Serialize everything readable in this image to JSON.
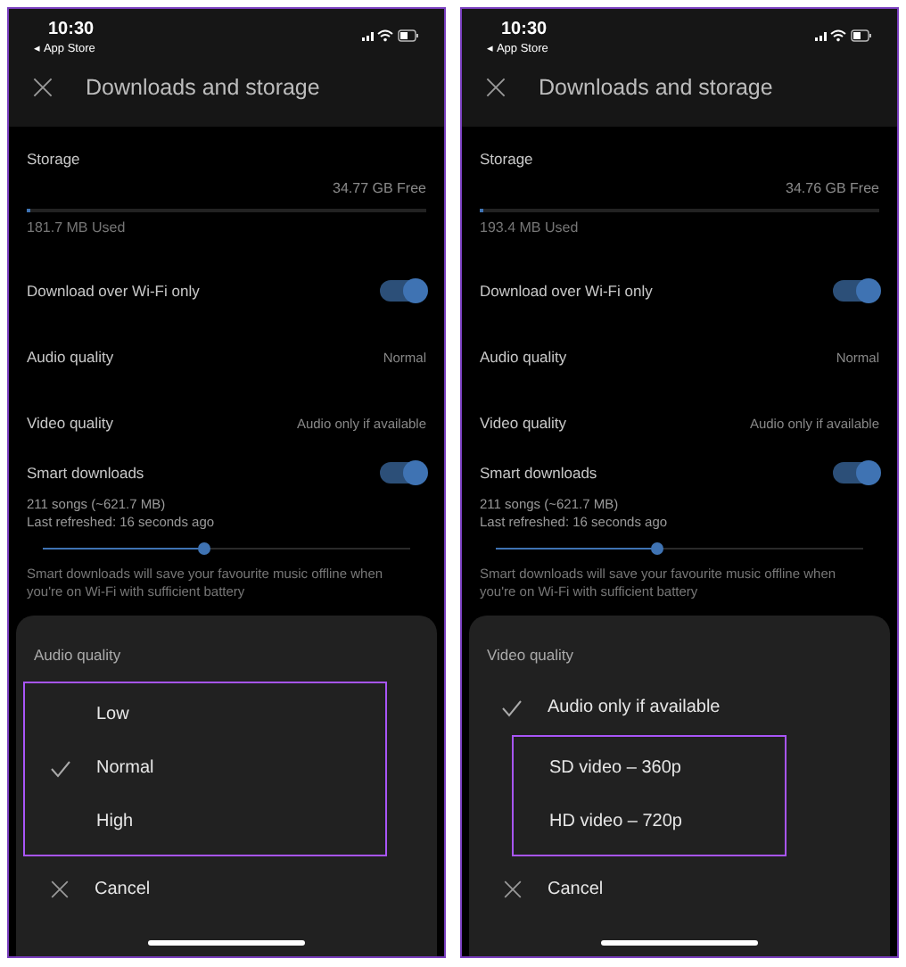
{
  "screens": [
    {
      "status_bar": {
        "time": "10:30",
        "back_label": "◂ App Store"
      },
      "header": {
        "title": "Downloads and storage"
      },
      "storage": {
        "label": "Storage",
        "free": "34.77 GB Free",
        "level": 0.01,
        "used": "181.7 MB Used"
      },
      "settings": [
        {
          "kind": "toggle",
          "label": "Download over Wi-Fi only",
          "on": true
        },
        {
          "kind": "value",
          "label": "Audio quality",
          "value": "Normal"
        },
        {
          "kind": "value",
          "label": "Video quality",
          "value": "Audio only if available"
        }
      ],
      "smart_downloads": {
        "label": "Smart downloads",
        "on": true,
        "count": "211 songs (~621.7 MB)",
        "refreshed": "Last refreshed: 16 seconds ago",
        "level": 0.44,
        "description": "Smart downloads will save your favourite music offline when you're on Wi-Fi with sufficient battery"
      },
      "sheet": {
        "title": "Audio quality",
        "options": [
          {
            "label": "Low",
            "selected": false,
            "highlighted": true
          },
          {
            "label": "Normal",
            "selected": true,
            "highlighted": true
          },
          {
            "label": "High",
            "selected": false,
            "highlighted": true
          }
        ],
        "cancel": "Cancel"
      }
    },
    {
      "status_bar": {
        "time": "10:30",
        "back_label": "◂ App Store"
      },
      "header": {
        "title": "Downloads and storage"
      },
      "storage": {
        "label": "Storage",
        "free": "34.76 GB Free",
        "level": 0.01,
        "used": "193.4 MB Used"
      },
      "settings": [
        {
          "kind": "toggle",
          "label": "Download over Wi-Fi only",
          "on": true
        },
        {
          "kind": "value",
          "label": "Audio quality",
          "value": "Normal"
        },
        {
          "kind": "value",
          "label": "Video quality",
          "value": "Audio only if available"
        }
      ],
      "smart_downloads": {
        "label": "Smart downloads",
        "on": true,
        "count": "211 songs (~621.7 MB)",
        "refreshed": "Last refreshed: 16 seconds ago",
        "level": 0.44,
        "description": "Smart downloads will save your favourite music offline when you're on Wi-Fi with sufficient battery"
      },
      "sheet": {
        "title": "Video quality",
        "options": [
          {
            "label": "Audio only if available",
            "selected": true,
            "highlighted": false
          },
          {
            "label": "SD video – 360p",
            "selected": false,
            "highlighted": true
          },
          {
            "label": "HD video – 720p",
            "selected": false,
            "highlighted": true
          }
        ],
        "cancel": "Cancel"
      }
    }
  ]
}
